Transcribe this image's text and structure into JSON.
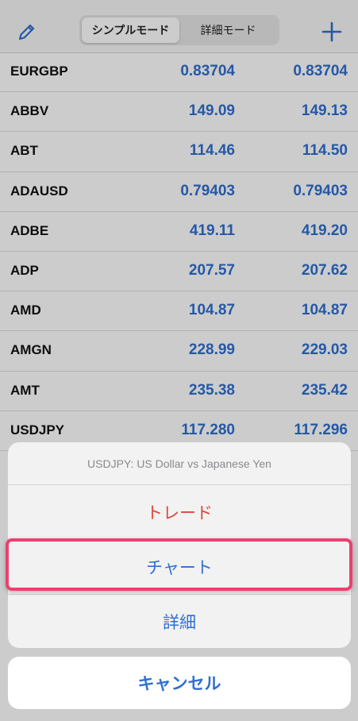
{
  "header": {
    "edit_icon": "pencil-icon",
    "add_icon": "plus-icon",
    "segments": [
      "シンプルモード",
      "詳細モード"
    ],
    "active_segment": 0
  },
  "quotes": [
    {
      "symbol": "EURGBP",
      "bid": "0.83704",
      "ask": "0.83704"
    },
    {
      "symbol": "ABBV",
      "bid": "149.09",
      "ask": "149.13"
    },
    {
      "symbol": "ABT",
      "bid": "114.46",
      "ask": "114.50"
    },
    {
      "symbol": "ADAUSD",
      "bid": "0.79403",
      "ask": "0.79403"
    },
    {
      "symbol": "ADBE",
      "bid": "419.11",
      "ask": "419.20"
    },
    {
      "symbol": "ADP",
      "bid": "207.57",
      "ask": "207.62"
    },
    {
      "symbol": "AMD",
      "bid": "104.87",
      "ask": "104.87"
    },
    {
      "symbol": "AMGN",
      "bid": "228.99",
      "ask": "229.03"
    },
    {
      "symbol": "AMT",
      "bid": "235.38",
      "ask": "235.42"
    },
    {
      "symbol": "USDJPY",
      "bid": "117.280",
      "ask": "117.296"
    }
  ],
  "action_sheet": {
    "title": "USDJPY: US Dollar vs Japanese Yen",
    "items": [
      {
        "label": "トレード",
        "style": "destructive"
      },
      {
        "label": "チャート",
        "style": "default",
        "highlighted": true
      },
      {
        "label": "詳細",
        "style": "default"
      }
    ],
    "cancel_label": "キャンセル"
  },
  "colors": {
    "accent": "#2f6fd1",
    "destructive": "#e0453a",
    "highlight": "#ee3f6e"
  }
}
